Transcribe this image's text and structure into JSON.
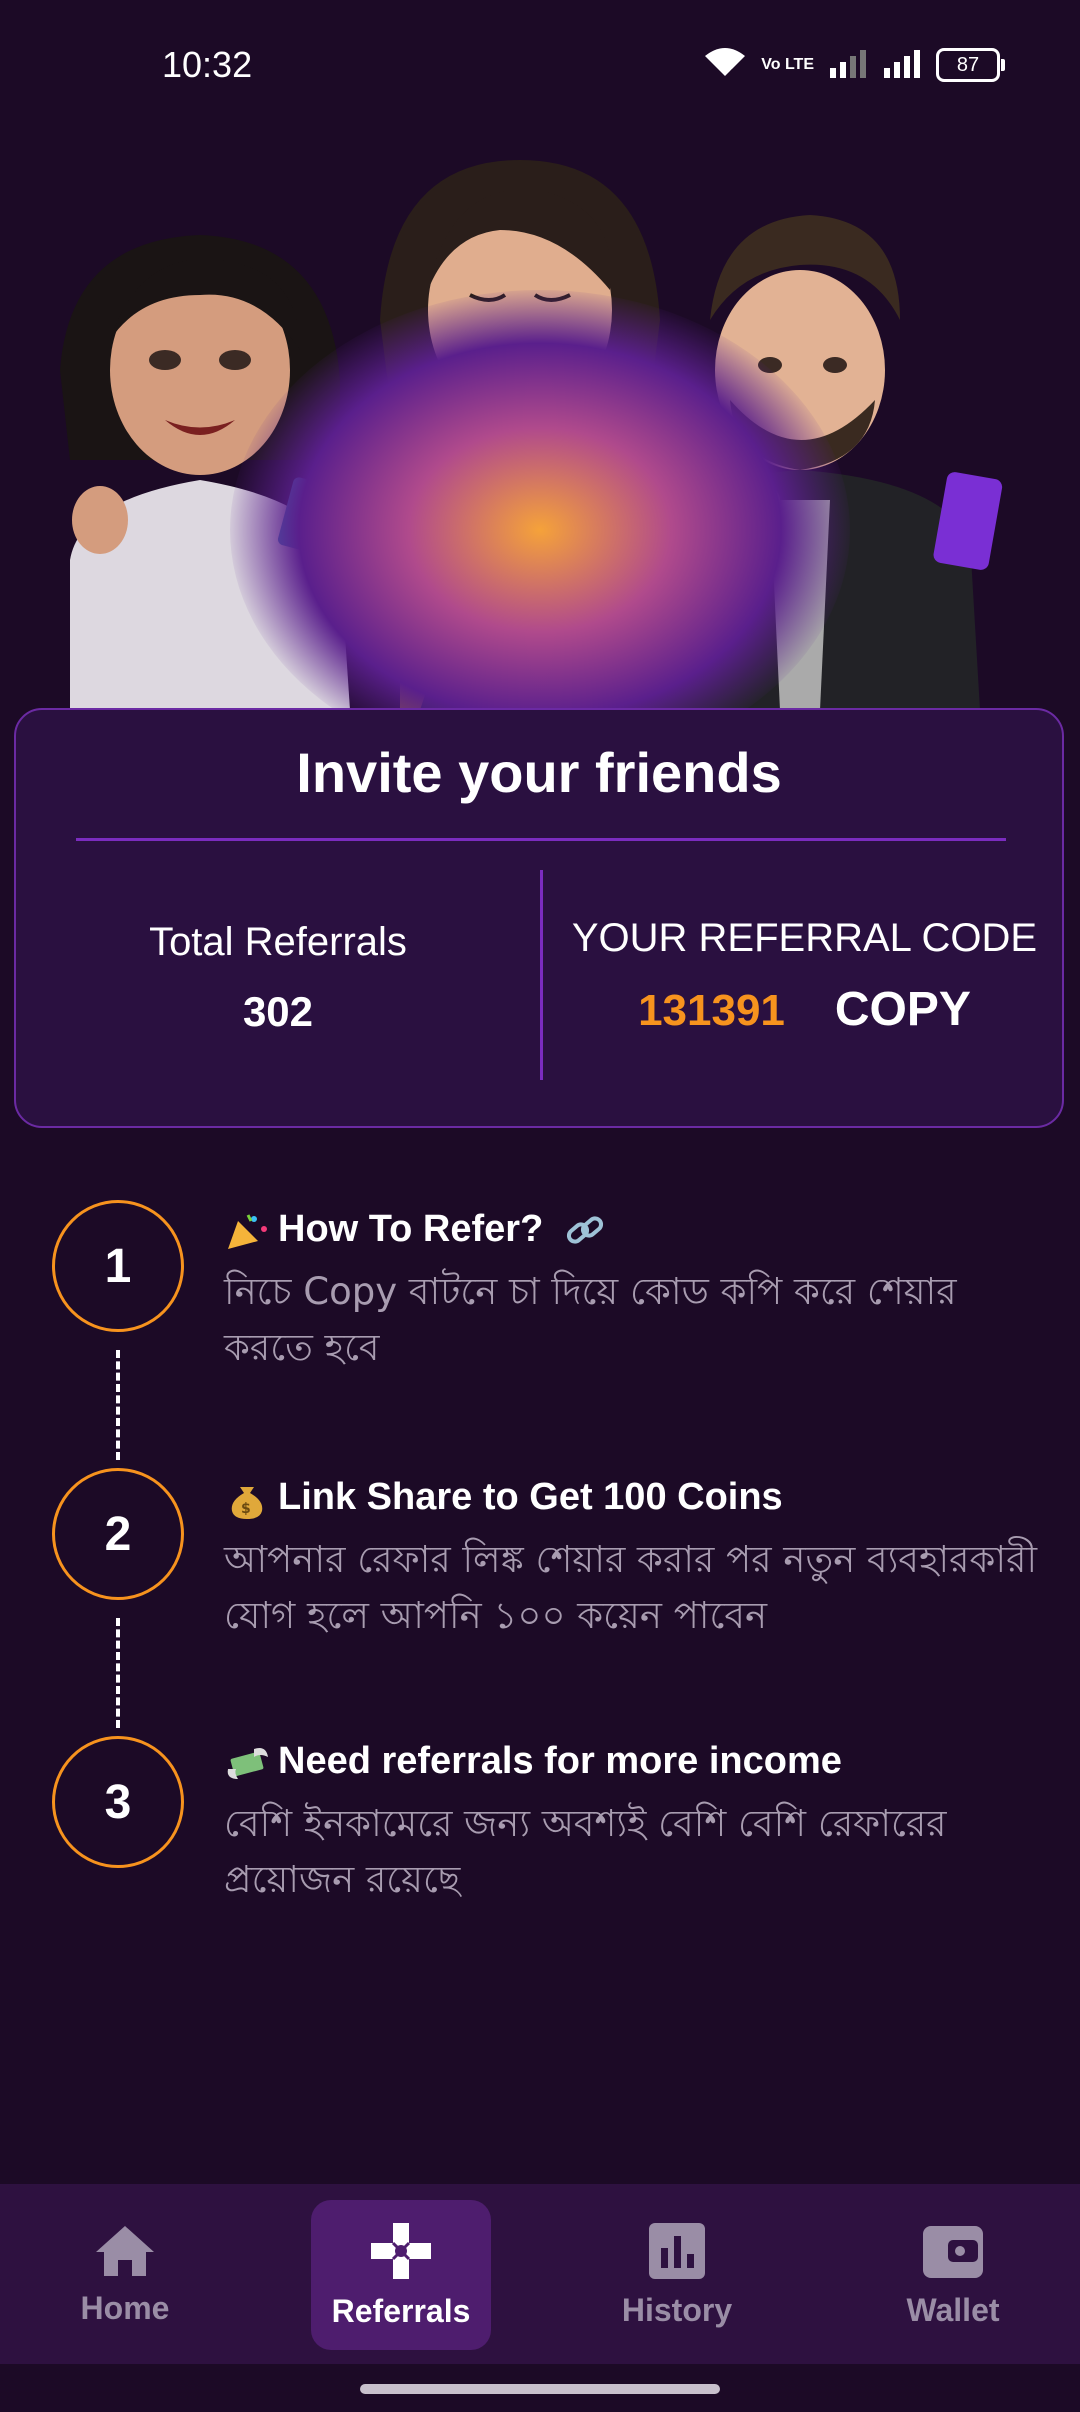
{
  "status_bar": {
    "time": "10:32",
    "network": "Vo LTE",
    "battery": "87"
  },
  "invite_card": {
    "title": "Invite your friends",
    "total_referrals_label": "Total Referrals",
    "total_referrals_value": "302",
    "code_label": "YOUR REFERRAL CODE",
    "code_value": "131391",
    "copy_label": "COPY"
  },
  "steps": [
    {
      "number": "1",
      "title": "How To Refer?",
      "description": "নিচে Copy বাটনে চা দিয়ে কোড কপি করে শেয়ার করতে হবে"
    },
    {
      "number": "2",
      "title": "Link Share to Get 100 Coins",
      "description": "আপনার রেফার লিঙ্ক শেয়ার করার পর নতুন ব্যবহারকারী যোগ হলে আপনি ১০০ কয়েন পাবেন"
    },
    {
      "number": "3",
      "title": "Need referrals for more income",
      "description": "বেশি ইনকামেরে জন্য অবশ্যই বেশি বেশি রেফারের প্রয়োজন রয়েছে"
    }
  ],
  "bottom_nav": [
    {
      "label": "Home",
      "icon": "home-icon",
      "active": false
    },
    {
      "label": "Referrals",
      "icon": "referrals-icon",
      "active": true
    },
    {
      "label": "History",
      "icon": "history-chart-icon",
      "active": false
    },
    {
      "label": "Wallet",
      "icon": "wallet-icon",
      "active": false
    }
  ],
  "colors": {
    "background": "#1c0a26",
    "card": "#2a1040",
    "accent": "#7b2cbf",
    "orange": "#f7931e",
    "nav_active": "#4e1d6e"
  }
}
